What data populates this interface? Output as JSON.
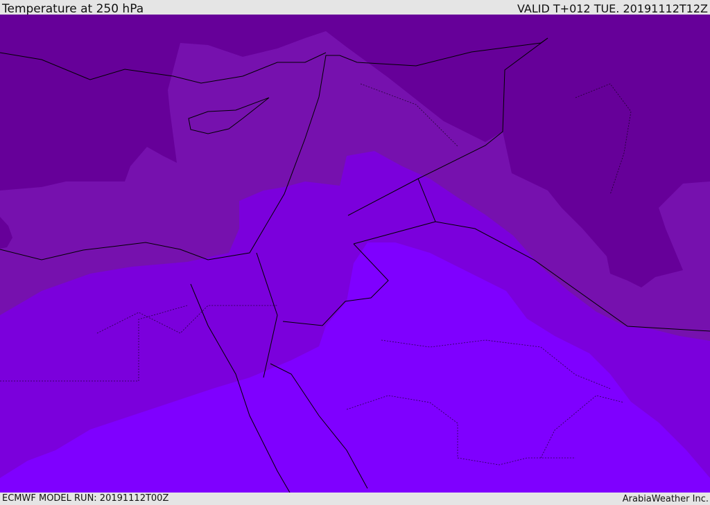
{
  "header": {
    "title": "Temperature at 250 hPa",
    "valid": "VALID T+012 TUE. 20191112T12Z"
  },
  "footer": {
    "model_run": "ECMWF MODEL RUN: 20191112T00Z",
    "brand": "ArabiaWeather Inc."
  },
  "map": {
    "colors": {
      "band_coldest": "#660099",
      "band_2": "#7611ae",
      "band_3": "#7b00dc",
      "band_warmest": "#7f00ff",
      "borders": "#000000"
    }
  }
}
